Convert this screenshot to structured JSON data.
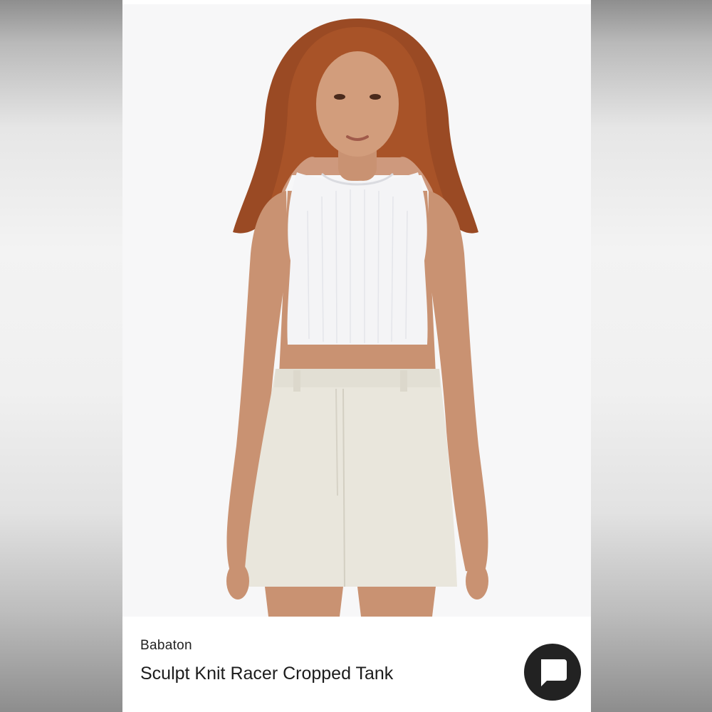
{
  "product": {
    "brand": "Babaton",
    "title": "Sculpt Knit Racer Cropped Tank"
  },
  "photo": {
    "subject": "product-model-photo"
  },
  "chat": {
    "icon": "chat-bubble-icon"
  },
  "colors": {
    "chat_button": "#222222",
    "photo_background": "#f7f7f8"
  }
}
